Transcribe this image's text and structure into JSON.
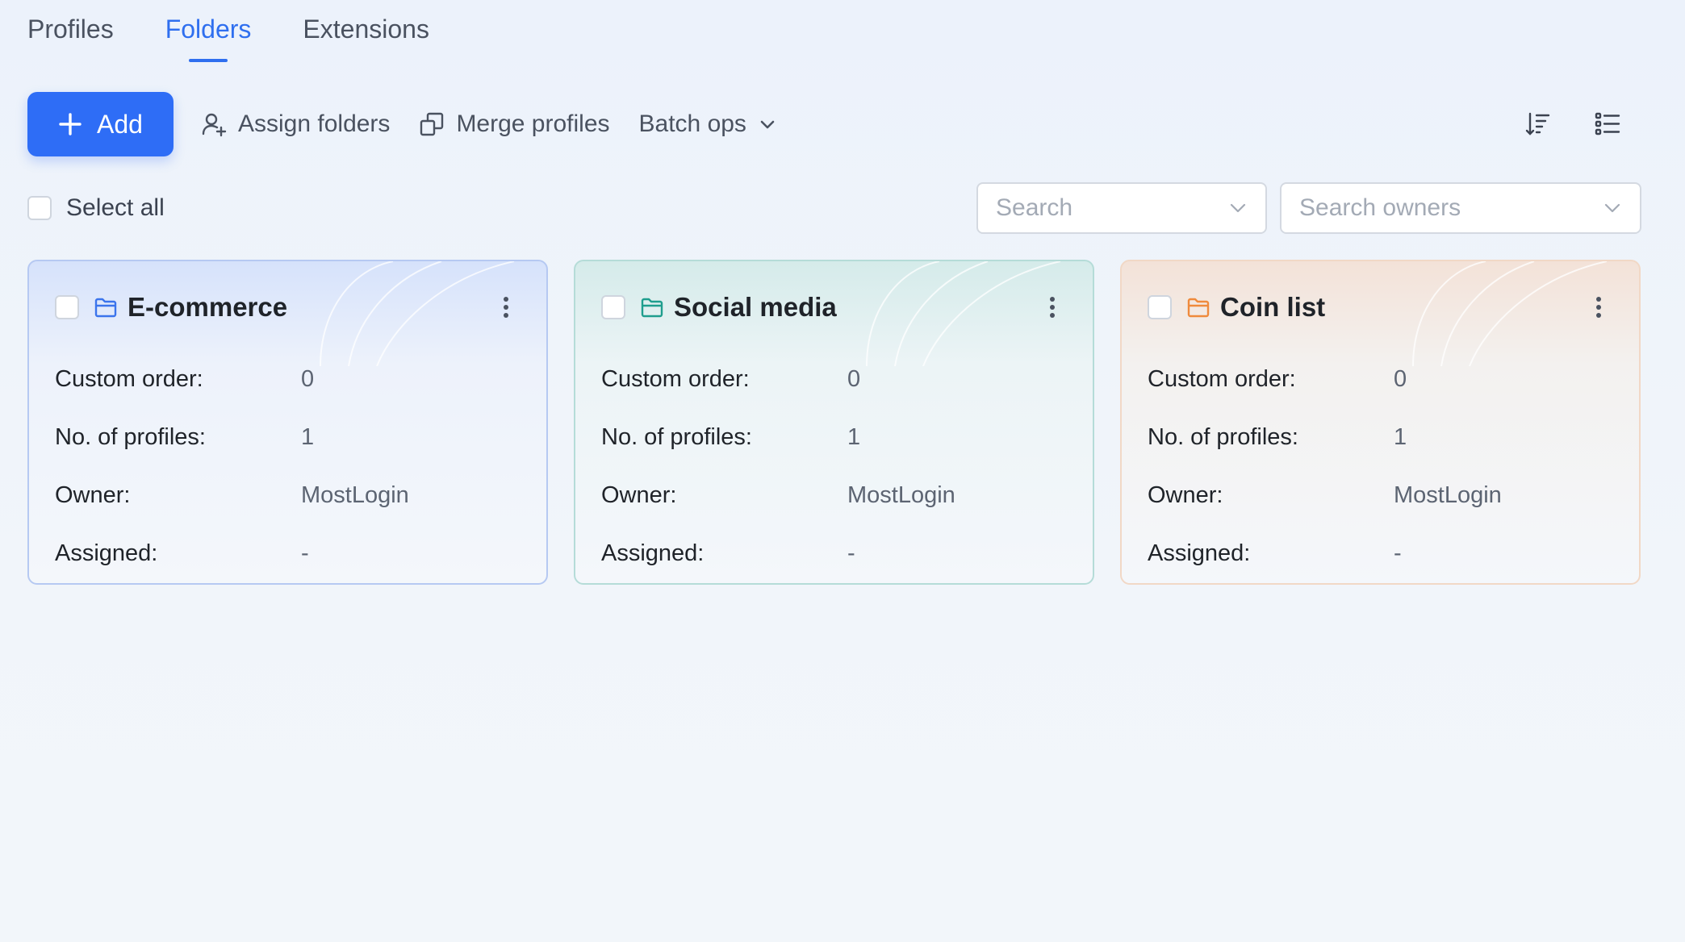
{
  "tabs": [
    {
      "label": "Profiles",
      "active": false
    },
    {
      "label": "Folders",
      "active": true
    },
    {
      "label": "Extensions",
      "active": false
    }
  ],
  "toolbar": {
    "add_label": "Add",
    "assign_label": "Assign folders",
    "merge_label": "Merge profiles",
    "batch_label": "Batch ops"
  },
  "filters": {
    "select_all_label": "Select all",
    "search_placeholder": "Search",
    "owners_placeholder": "Search owners"
  },
  "field_labels": {
    "custom_order": "Custom order:",
    "profiles": "No. of profiles:",
    "owner": "Owner:",
    "assigned": "Assigned:"
  },
  "cards": [
    {
      "title": "E-commerce",
      "custom_order": "0",
      "profiles": "1",
      "owner": "MostLogin",
      "assigned": "-",
      "color": "#3b74ec"
    },
    {
      "title": "Social media",
      "custom_order": "0",
      "profiles": "1",
      "owner": "MostLogin",
      "assigned": "-",
      "color": "#1f9e8e"
    },
    {
      "title": "Coin list",
      "custom_order": "0",
      "profiles": "1",
      "owner": "MostLogin",
      "assigned": "-",
      "color": "#ef8a3c"
    }
  ],
  "colors": {
    "accent": "#2e6df6",
    "tab_active": "#2f6fef"
  }
}
